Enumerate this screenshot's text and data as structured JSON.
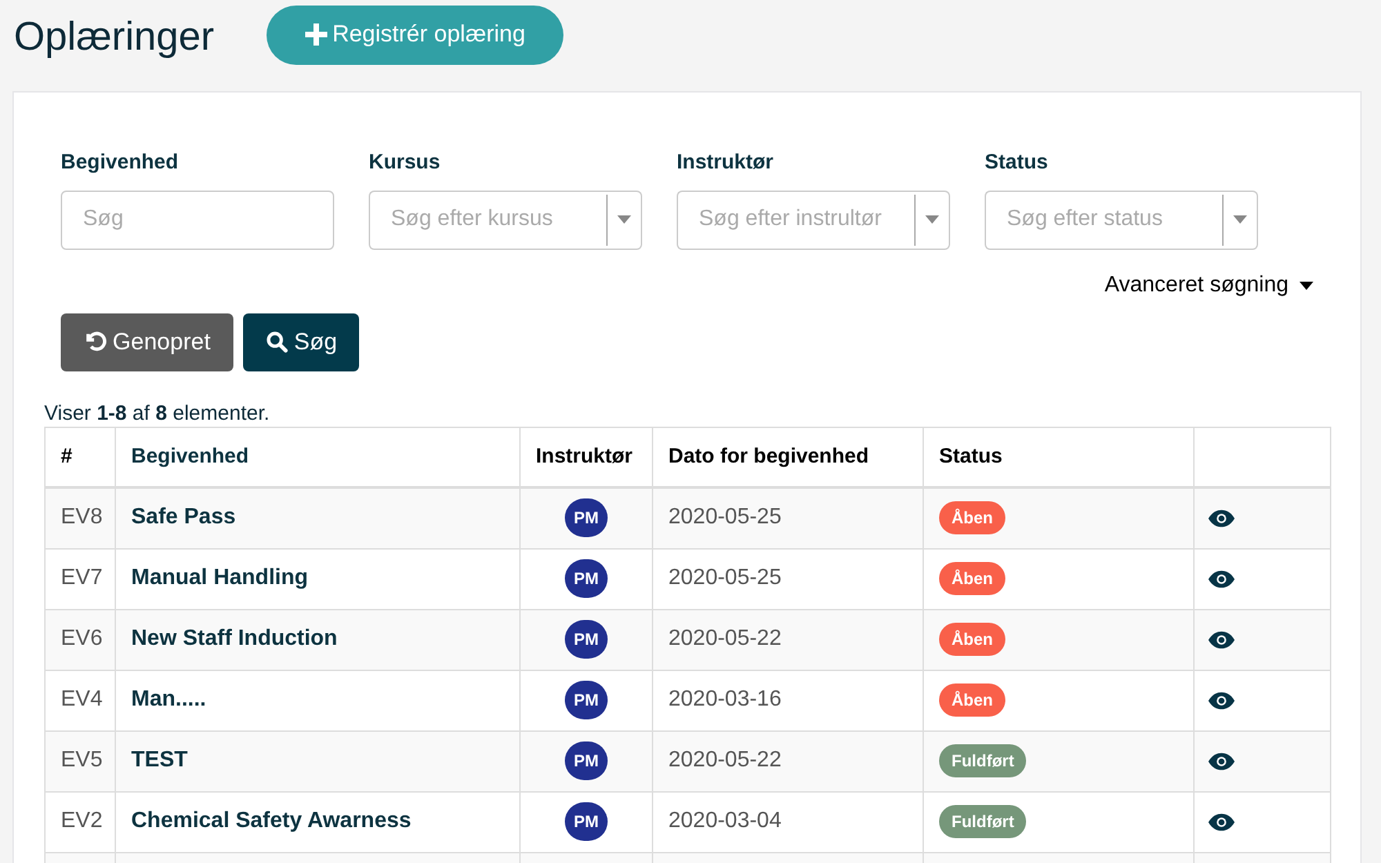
{
  "page": {
    "title": "Oplæringer",
    "add_button": "Registrér oplæring"
  },
  "filters": [
    {
      "label": "Begivenhed",
      "placeholder": "Søg",
      "kind": "text"
    },
    {
      "label": "Kursus",
      "placeholder": "Søg efter kursus",
      "kind": "select"
    },
    {
      "label": "Instruktør",
      "placeholder": "Søg efter instrultør",
      "kind": "select"
    },
    {
      "label": "Status",
      "placeholder": "Søg efter status",
      "kind": "select"
    }
  ],
  "advanced_search": "Avanceret søgning",
  "buttons": {
    "reset": "Genopret",
    "search": "Søg"
  },
  "summary": "Viser **1-8** af **8** elementer.",
  "table": {
    "columns": [
      "#",
      "Begivenhed",
      "Instruktør",
      "Dato for begivenhed",
      "Status"
    ],
    "rows": [
      {
        "id": "EV8",
        "event": "Safe Pass",
        "instructor": "PM",
        "date": "2020-05-25",
        "status": "Åben",
        "color": "#f9604a"
      },
      {
        "id": "EV7",
        "event": "Manual Handling",
        "instructor": "PM",
        "date": "2020-05-25",
        "status": "Åben",
        "color": "#f9604a"
      },
      {
        "id": "EV6",
        "event": "New Staff Induction",
        "instructor": "PM",
        "date": "2020-05-22",
        "status": "Åben",
        "color": "#f9604a"
      },
      {
        "id": "EV4",
        "event": "Man.....",
        "instructor": "PM",
        "date": "2020-03-16",
        "status": "Åben",
        "color": "#f9604a"
      },
      {
        "id": "EV5",
        "event": "TEST",
        "instructor": "PM",
        "date": "2020-05-22",
        "status": "Fuldført",
        "color": "#76977a"
      },
      {
        "id": "EV2",
        "event": "Chemical Safety Awarness",
        "instructor": "PM",
        "date": "2020-03-04",
        "status": "Fuldført",
        "color": "#76977a"
      }
    ]
  }
}
